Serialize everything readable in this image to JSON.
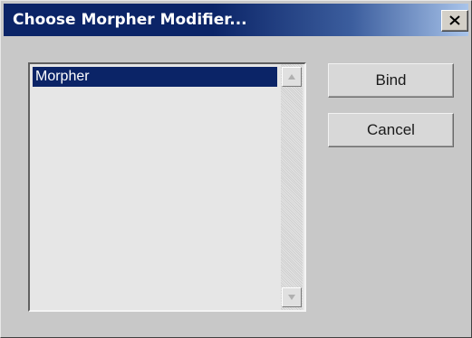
{
  "dialog": {
    "title": "Choose Morpher Modifier...",
    "close_icon": "close-icon",
    "list": {
      "items": [
        {
          "label": "Morpher",
          "selected": true
        }
      ],
      "scroll_up_icon": "triangle-up-icon",
      "scroll_down_icon": "triangle-down-icon"
    },
    "buttons": {
      "bind_label": "Bind",
      "cancel_label": "Cancel"
    }
  },
  "colors": {
    "titlebar_start": "#0b2467",
    "titlebar_end": "#a9c4ea",
    "selection": "#0b2467",
    "dialog_bg": "#c8c8c8"
  }
}
